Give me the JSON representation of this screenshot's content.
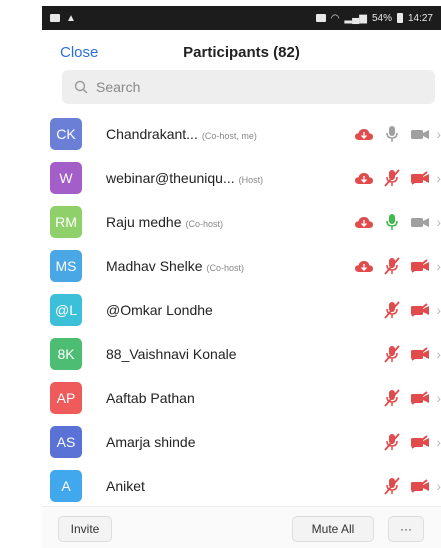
{
  "status_bar": {
    "battery": "54%",
    "time": "14:27"
  },
  "header": {
    "close_label": "Close",
    "title": "Participants (82)"
  },
  "search": {
    "placeholder": "Search"
  },
  "participants": [
    {
      "initials": "CK",
      "color": "#6b7fd7",
      "name": "Chandrakant...",
      "role": "(Co-host, me)",
      "cloud": true,
      "mic": "gray",
      "video": "gray"
    },
    {
      "initials": "W",
      "color": "#a35ec9",
      "name": "webinar@theuniqu...",
      "role": "(Host)",
      "cloud": true,
      "mic": "muted",
      "video": "muted"
    },
    {
      "initials": "RM",
      "color": "#8fd06b",
      "name": "Raju medhe",
      "role": "(Co-host)",
      "cloud": true,
      "mic": "green",
      "video": "gray"
    },
    {
      "initials": "MS",
      "color": "#4aa7e6",
      "name": "Madhav Shelke",
      "role": "(Co-host)",
      "cloud": true,
      "mic": "muted",
      "video": "muted"
    },
    {
      "initials": "@L",
      "color": "#3cc0d9",
      "name": "@Omkar Londhe",
      "role": "",
      "cloud": false,
      "mic": "muted",
      "video": "muted"
    },
    {
      "initials": "8K",
      "color": "#4cbd72",
      "name": "88_Vaishnavi Konale",
      "role": "",
      "cloud": false,
      "mic": "muted",
      "video": "muted"
    },
    {
      "initials": "AP",
      "color": "#ef5a5a",
      "name": "Aaftab Pathan",
      "role": "",
      "cloud": false,
      "mic": "muted",
      "video": "muted"
    },
    {
      "initials": "AS",
      "color": "#5a72d6",
      "name": "Amarja shinde",
      "role": "",
      "cloud": false,
      "mic": "muted",
      "video": "muted"
    },
    {
      "initials": "A",
      "color": "#42a8ee",
      "name": "Aniket",
      "role": "",
      "cloud": false,
      "mic": "muted",
      "video": "muted"
    }
  ],
  "footer": {
    "invite_label": "Invite",
    "mute_all_label": "Mute All",
    "more_label": "···"
  }
}
